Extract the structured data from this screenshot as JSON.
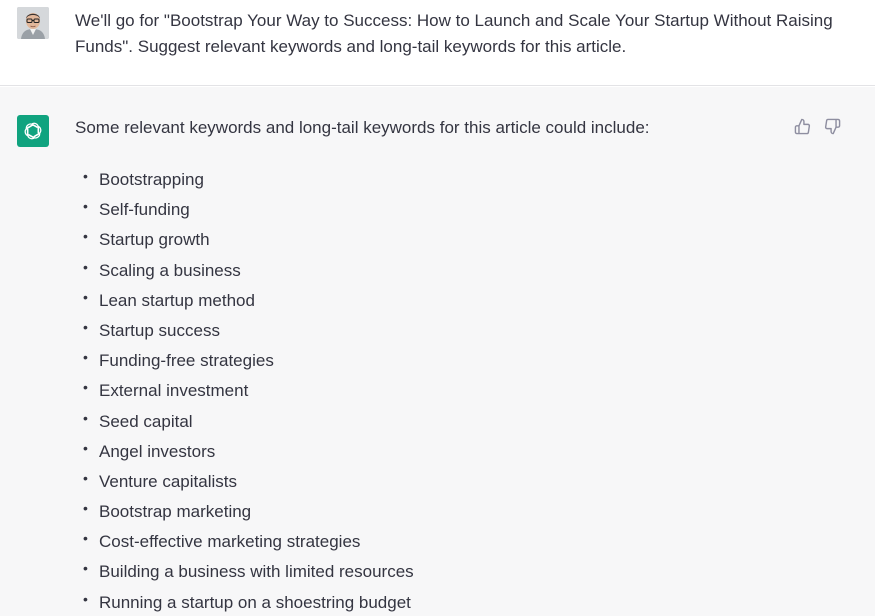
{
  "user_message": {
    "text": "We'll go for \"Bootstrap Your Way to Success: How to Launch and Scale Your Startup Without Raising Funds\". Suggest relevant keywords and long-tail keywords for this article."
  },
  "assistant_message": {
    "intro": "Some relevant keywords and long-tail keywords for this article could include:",
    "keywords": [
      "Bootstrapping",
      "Self-funding",
      "Startup growth",
      "Scaling a business",
      "Lean startup method",
      "Startup success",
      "Funding-free strategies",
      "External investment",
      "Seed capital",
      "Angel investors",
      "Venture capitalists",
      "Bootstrap marketing",
      "Cost-effective marketing strategies",
      "Building a business with limited resources",
      "Running a startup on a shoestring budget"
    ]
  },
  "icons": {
    "user_avatar": "user-avatar",
    "assistant_avatar": "openai-logo-icon",
    "like": "thumbs-up-icon",
    "dislike": "thumbs-down-icon"
  },
  "colors": {
    "assistant_bg": "#f7f7f8",
    "assistant_avatar_bg": "#10a37f",
    "text": "#343541"
  }
}
